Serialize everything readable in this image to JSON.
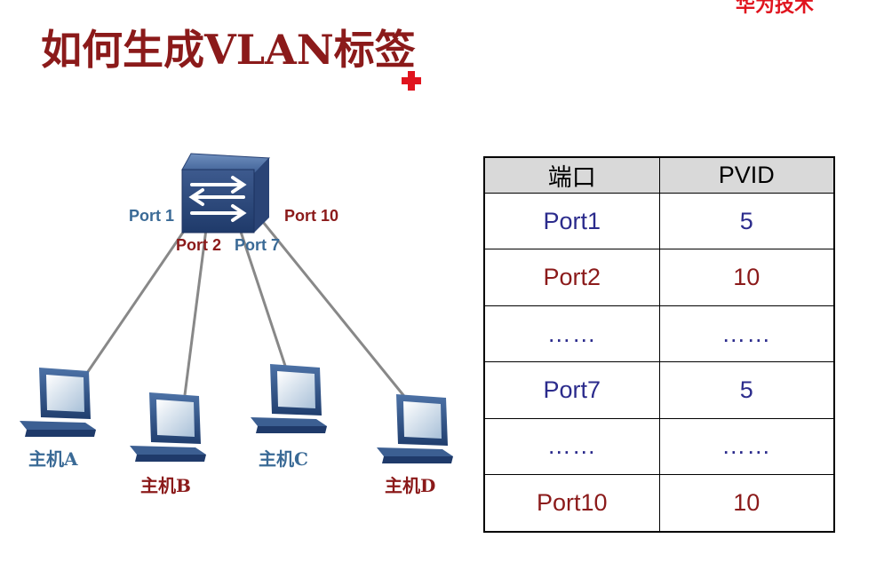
{
  "header": {
    "title": "如何生成VLAN标签",
    "corner_text": "华为技术"
  },
  "diagram": {
    "switch_label_ports": {
      "port1": "Port 1",
      "port2": "Port 2",
      "port7": "Port 7",
      "port10": "Port 10"
    },
    "hosts": {
      "a": "主机A",
      "b": "主机B",
      "c": "主机C",
      "d": "主机D"
    }
  },
  "table": {
    "headers": [
      "端口",
      "PVID"
    ],
    "rows": [
      [
        "Port1",
        "5"
      ],
      [
        "Port2",
        "10"
      ],
      [
        "……",
        "……"
      ],
      [
        "Port7",
        "5"
      ],
      [
        "……",
        "……"
      ],
      [
        "Port10",
        "10"
      ]
    ]
  },
  "colors": {
    "title": "#8b1a1a",
    "blue_text": "#3a6a96",
    "red_text": "#8b1a1a",
    "accent_red": "#e0141e"
  }
}
